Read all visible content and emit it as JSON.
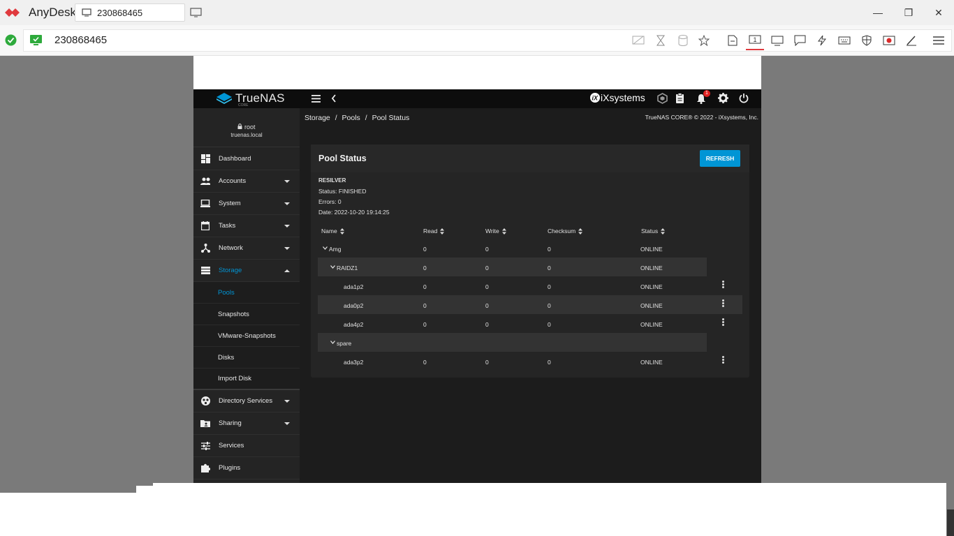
{
  "app": {
    "title": "AnyDesk",
    "tab_label": "230868465",
    "address": "230868465"
  },
  "colors": {
    "anydesk_red": "#e03a3e",
    "accent": "#0095d5",
    "badge": "#e02020",
    "truenas_blue": "#0095d5"
  },
  "remote": {
    "brand": "TrueNAS",
    "brand_sub": "CORE",
    "vendor": "iXsystems",
    "notification_count": "1",
    "user": {
      "name": "root",
      "host": "truenas.local"
    },
    "sidebar": {
      "items": [
        {
          "label": "Dashboard",
          "icon": "dashboard-icon",
          "caret": "none"
        },
        {
          "label": "Accounts",
          "icon": "accounts-icon",
          "caret": "down"
        },
        {
          "label": "System",
          "icon": "laptop-icon",
          "caret": "down"
        },
        {
          "label": "Tasks",
          "icon": "calendar-icon",
          "caret": "down"
        },
        {
          "label": "Network",
          "icon": "network-icon",
          "caret": "down"
        },
        {
          "label": "Storage",
          "icon": "storage-icon",
          "caret": "up"
        }
      ],
      "storage_sub": [
        "Pools",
        "Snapshots",
        "VMware-Snapshots",
        "Disks",
        "Import Disk"
      ],
      "items2": [
        {
          "label": "Directory Services",
          "icon": "directory-icon",
          "caret": "down"
        },
        {
          "label": "Sharing",
          "icon": "sharing-folder-icon",
          "caret": "down"
        },
        {
          "label": "Services",
          "icon": "sliders-icon",
          "caret": "none"
        },
        {
          "label": "Plugins",
          "icon": "puzzle-icon",
          "caret": "none"
        }
      ]
    },
    "breadcrumb": {
      "a": "Storage",
      "b": "Pools",
      "c": "Pool Status",
      "sep": "/"
    },
    "copyright": "TrueNAS CORE® © 2022 - iXsystems, Inc.",
    "pool": {
      "title": "Pool Status",
      "refresh": "REFRESH",
      "resilver": {
        "heading": "RESILVER",
        "status": "Status: FINISHED",
        "errors": "Errors: 0",
        "date": "Date: 2022-10-20 19:14:25"
      },
      "columns": [
        "Name",
        "Read",
        "Write",
        "Checksum",
        "Status"
      ],
      "rows": [
        {
          "name": "Amg",
          "read": "0",
          "write": "0",
          "checksum": "0",
          "status": "ONLINE"
        },
        {
          "name": "RAIDZ1",
          "read": "0",
          "write": "0",
          "checksum": "0",
          "status": "ONLINE"
        },
        {
          "name": "ada1p2",
          "read": "0",
          "write": "0",
          "checksum": "0",
          "status": "ONLINE"
        },
        {
          "name": "ada0p2",
          "read": "0",
          "write": "0",
          "checksum": "0",
          "status": "ONLINE"
        },
        {
          "name": "ada4p2",
          "read": "0",
          "write": "0",
          "checksum": "0",
          "status": "ONLINE"
        },
        {
          "name": "spare",
          "read": "",
          "write": "",
          "checksum": "",
          "status": ""
        },
        {
          "name": "ada3p2",
          "read": "0",
          "write": "0",
          "checksum": "0",
          "status": "ONLINE"
        }
      ]
    }
  }
}
